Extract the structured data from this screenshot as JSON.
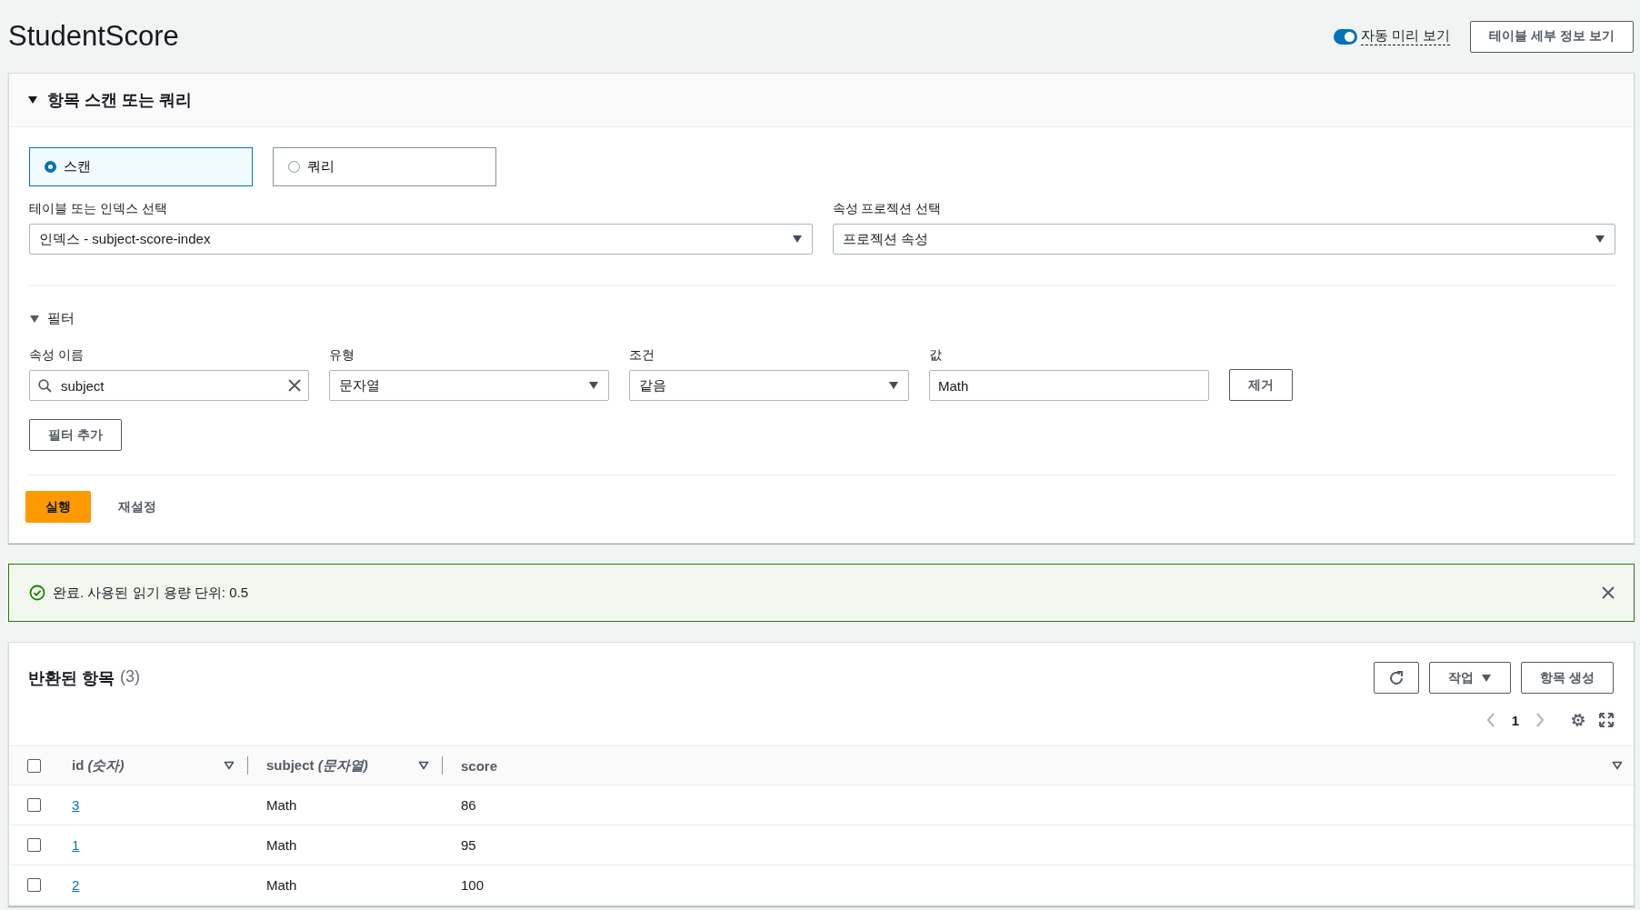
{
  "title": "StudentScore",
  "auto_preview": {
    "label": "자동 미리 보기",
    "on": true
  },
  "details_button": "테이블 세부 정보 보기",
  "query_panel": {
    "title": "항목 스캔 또는 쿼리",
    "expanded": true,
    "modes": [
      {
        "label": "스캔",
        "selected": true
      },
      {
        "label": "쿼리",
        "selected": false
      }
    ],
    "table_select": {
      "label": "테이블 또는 인덱스 선택",
      "value": "인덱스 - subject-score-index"
    },
    "projection_select": {
      "label": "속성 프로젝션 선택",
      "value": "프로젝션 속성"
    },
    "filter": {
      "title": "필터",
      "expanded": true,
      "rows": [
        {
          "attribute_label": "속성 이름",
          "attribute": "subject",
          "type_label": "유형",
          "type": "문자열",
          "condition_label": "조건",
          "condition": "같음",
          "value_label": "값",
          "value": "Math",
          "remove": "제거"
        }
      ],
      "add_button": "필터 추가"
    },
    "run_button": "실행",
    "reset_button": "재설정"
  },
  "banner": {
    "message": "완료. 사용된 읽기 용량 단위: 0.5"
  },
  "results": {
    "title": "반환된 항목",
    "count": "(3)",
    "actions_button": "작업",
    "create_button": "항목 생성",
    "page": "1",
    "select_all": {
      "checked": false
    },
    "columns": [
      {
        "label": "id *(숫자)*"
      },
      {
        "label": "subject *(문자열)*"
      },
      {
        "label": "score"
      }
    ],
    "rows": [
      {
        "selected": false,
        "id": "3",
        "subject": "Math",
        "score": "86"
      },
      {
        "selected": false,
        "id": "1",
        "subject": "Math",
        "score": "95"
      },
      {
        "selected": false,
        "id": "2",
        "subject": "Math",
        "score": "100"
      }
    ]
  }
}
